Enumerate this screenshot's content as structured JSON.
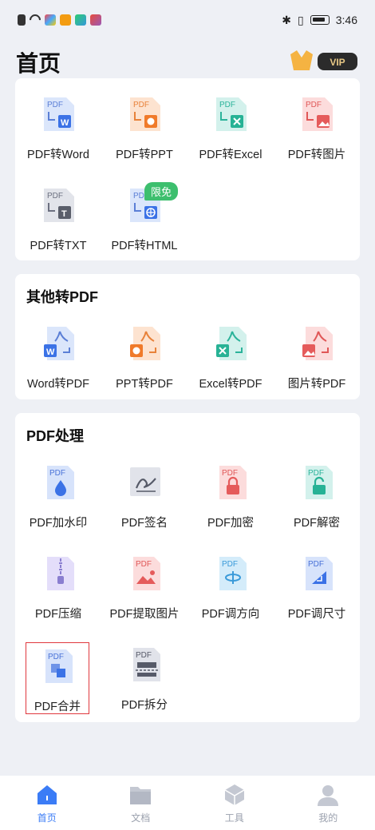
{
  "status_bar": {
    "time": "3:46"
  },
  "header": {
    "title": "首页",
    "vip_label": "VIP"
  },
  "sections": {
    "pdf_convert": {
      "items": [
        {
          "label": "PDF转Word",
          "icon": "pdf-to-word-icon"
        },
        {
          "label": "PDF转PPT",
          "icon": "pdf-to-ppt-icon"
        },
        {
          "label": "PDF转Excel",
          "icon": "pdf-to-excel-icon"
        },
        {
          "label": "PDF转图片",
          "icon": "pdf-to-image-icon"
        },
        {
          "label": "PDF转TXT",
          "icon": "pdf-to-txt-icon"
        },
        {
          "label": "PDF转HTML",
          "icon": "pdf-to-html-icon",
          "tag": "限免"
        }
      ]
    },
    "to_pdf": {
      "title": "其他转PDF",
      "items": [
        {
          "label": "Word转PDF",
          "icon": "word-to-pdf-icon"
        },
        {
          "label": "PPT转PDF",
          "icon": "ppt-to-pdf-icon"
        },
        {
          "label": "Excel转PDF",
          "icon": "excel-to-pdf-icon"
        },
        {
          "label": "图片转PDF",
          "icon": "image-to-pdf-icon"
        }
      ]
    },
    "pdf_process": {
      "title": "PDF处理",
      "items": [
        {
          "label": "PDF加水印",
          "icon": "watermark-icon"
        },
        {
          "label": "PDF签名",
          "icon": "signature-icon"
        },
        {
          "label": "PDF加密",
          "icon": "lock-icon"
        },
        {
          "label": "PDF解密",
          "icon": "unlock-icon"
        },
        {
          "label": "PDF压缩",
          "icon": "compress-icon"
        },
        {
          "label": "PDF提取图片",
          "icon": "extract-image-icon"
        },
        {
          "label": "PDF调方向",
          "icon": "rotate-icon"
        },
        {
          "label": "PDF调尺寸",
          "icon": "resize-icon"
        },
        {
          "label": "PDF合并",
          "icon": "merge-icon"
        },
        {
          "label": "PDF拆分",
          "icon": "split-icon"
        }
      ]
    }
  },
  "tab_bar": [
    {
      "label": "首页",
      "icon": "home-icon",
      "active": true
    },
    {
      "label": "文档",
      "icon": "folder-icon"
    },
    {
      "label": "工具",
      "icon": "toolbox-icon"
    },
    {
      "label": "我的",
      "icon": "user-icon"
    }
  ],
  "colors": {
    "accent": "#3b7cf6",
    "free_tag": "#3dbf6e",
    "selection": "#e0383e"
  }
}
